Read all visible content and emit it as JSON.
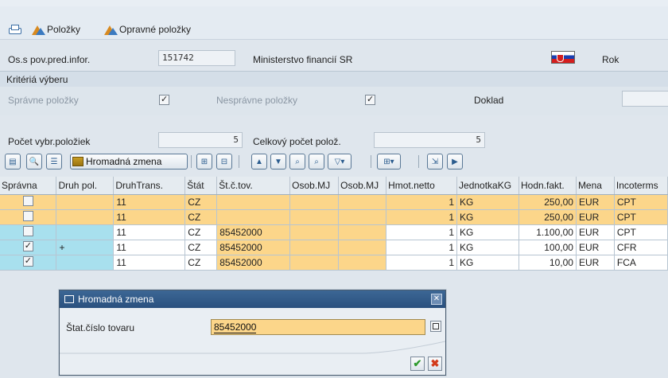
{
  "toolbar": {
    "polozky_label": "Položky",
    "opravne_polozky_label": "Opravné položky"
  },
  "header": {
    "os_label": "Os.s pov.pred.infor.",
    "os_value": "151742",
    "ministry": "Ministerstvo financií SR",
    "rok_label": "Rok"
  },
  "criteria": {
    "section_label": "Kritériá výberu",
    "spravne_label": "Správne položky",
    "spravne_checked": true,
    "nespravne_label": "Nesprávne položky",
    "nespravne_checked": true,
    "doklad_label": "Doklad"
  },
  "counts": {
    "pocet_label": "Počet vybr.položiek",
    "pocet_value": "5",
    "celkovy_label": "Celkový počet polož.",
    "celkovy_value": "5"
  },
  "grid_toolbar": {
    "hromadna_label": "Hromadná zmena"
  },
  "table": {
    "columns": [
      "Správna",
      "Druh pol.",
      "DruhTrans.",
      "Štát",
      "Št.č.tov.",
      "Osob.MJ",
      "Osob.MJ",
      "Hmot.netto",
      "JednotkaKG",
      "Hodn.fakt.",
      "Mena",
      "Incoterms"
    ],
    "rows": [
      {
        "spravna": false,
        "druh_pol": "",
        "druh_trans": "11",
        "stat": "CZ",
        "st_c_tov": "",
        "osob1": "",
        "osob2": "",
        "hmot": "1",
        "jedn": "KG",
        "hodn": "250,00",
        "mena": "EUR",
        "inco": "CPT",
        "selected": true
      },
      {
        "spravna": false,
        "druh_pol": "",
        "druh_trans": "11",
        "stat": "CZ",
        "st_c_tov": "",
        "osob1": "",
        "osob2": "",
        "hmot": "1",
        "jedn": "KG",
        "hodn": "250,00",
        "mena": "EUR",
        "inco": "CPT",
        "selected": true
      },
      {
        "spravna": false,
        "druh_pol": "",
        "druh_trans": "11",
        "stat": "CZ",
        "st_c_tov": "85452000",
        "osob1": "",
        "osob2": "",
        "hmot": "1",
        "jedn": "KG",
        "hodn": "1.100,00",
        "mena": "EUR",
        "inco": "CPT",
        "selected": false
      },
      {
        "spravna": true,
        "druh_pol": "+",
        "druh_trans": "11",
        "stat": "CZ",
        "st_c_tov": "85452000",
        "osob1": "",
        "osob2": "",
        "hmot": "1",
        "jedn": "KG",
        "hodn": "100,00",
        "mena": "EUR",
        "inco": "CFR",
        "selected": false
      },
      {
        "spravna": true,
        "druh_pol": "",
        "druh_trans": "11",
        "stat": "CZ",
        "st_c_tov": "85452000",
        "osob1": "",
        "osob2": "",
        "hmot": "1",
        "jedn": "KG",
        "hodn": "10,00",
        "mena": "EUR",
        "inco": "FCA",
        "selected": false
      }
    ]
  },
  "dialog": {
    "title": "Hromadná zmena",
    "field_label": "Štat.číslo tovaru",
    "field_value": "85452000",
    "close_glyph": "✕",
    "ok_glyph": "✔",
    "cancel_glyph": "✖"
  },
  "colors": {
    "selection": "#fcd68a",
    "key_column": "#a8e0ee",
    "title_bar": "#2f5a8a"
  }
}
